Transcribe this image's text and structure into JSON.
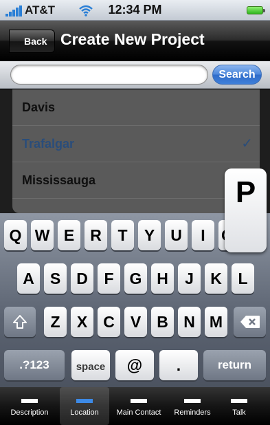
{
  "status_bar": {
    "carrier": "AT&T",
    "time": "12:34 PM"
  },
  "navbar": {
    "back_label": "Back",
    "title": "Create New Project"
  },
  "search": {
    "placeholder": "",
    "value": "",
    "button_label": "Search"
  },
  "list": {
    "items": [
      {
        "label": "Davis",
        "selected": false
      },
      {
        "label": "Trafalgar",
        "selected": true,
        "check": "✓"
      },
      {
        "label": "Mississauga",
        "selected": false
      }
    ]
  },
  "keyboard": {
    "row1": [
      "Q",
      "W",
      "E",
      "R",
      "T",
      "Y",
      "U",
      "I",
      "O"
    ],
    "row2": [
      "A",
      "S",
      "D",
      "F",
      "G",
      "H",
      "J",
      "K",
      "L"
    ],
    "row3": [
      "Z",
      "X",
      "C",
      "V",
      "B",
      "N",
      "M"
    ],
    "numbers_label": ".?123",
    "space_label": "space",
    "at_label": "@",
    "dot_label": ".",
    "return_label": "return",
    "popup_key": "P"
  },
  "tabbar": {
    "tabs": [
      {
        "label": "Description",
        "active": false
      },
      {
        "label": "Location",
        "active": true
      },
      {
        "label": "Main Contact",
        "active": false
      },
      {
        "label": "Reminders",
        "active": false
      },
      {
        "label": "Talk",
        "active": false
      }
    ]
  },
  "colors": {
    "accent": "#3d8ae6",
    "selected_text": "#2a4d7a",
    "search_button": "#4a86db"
  }
}
